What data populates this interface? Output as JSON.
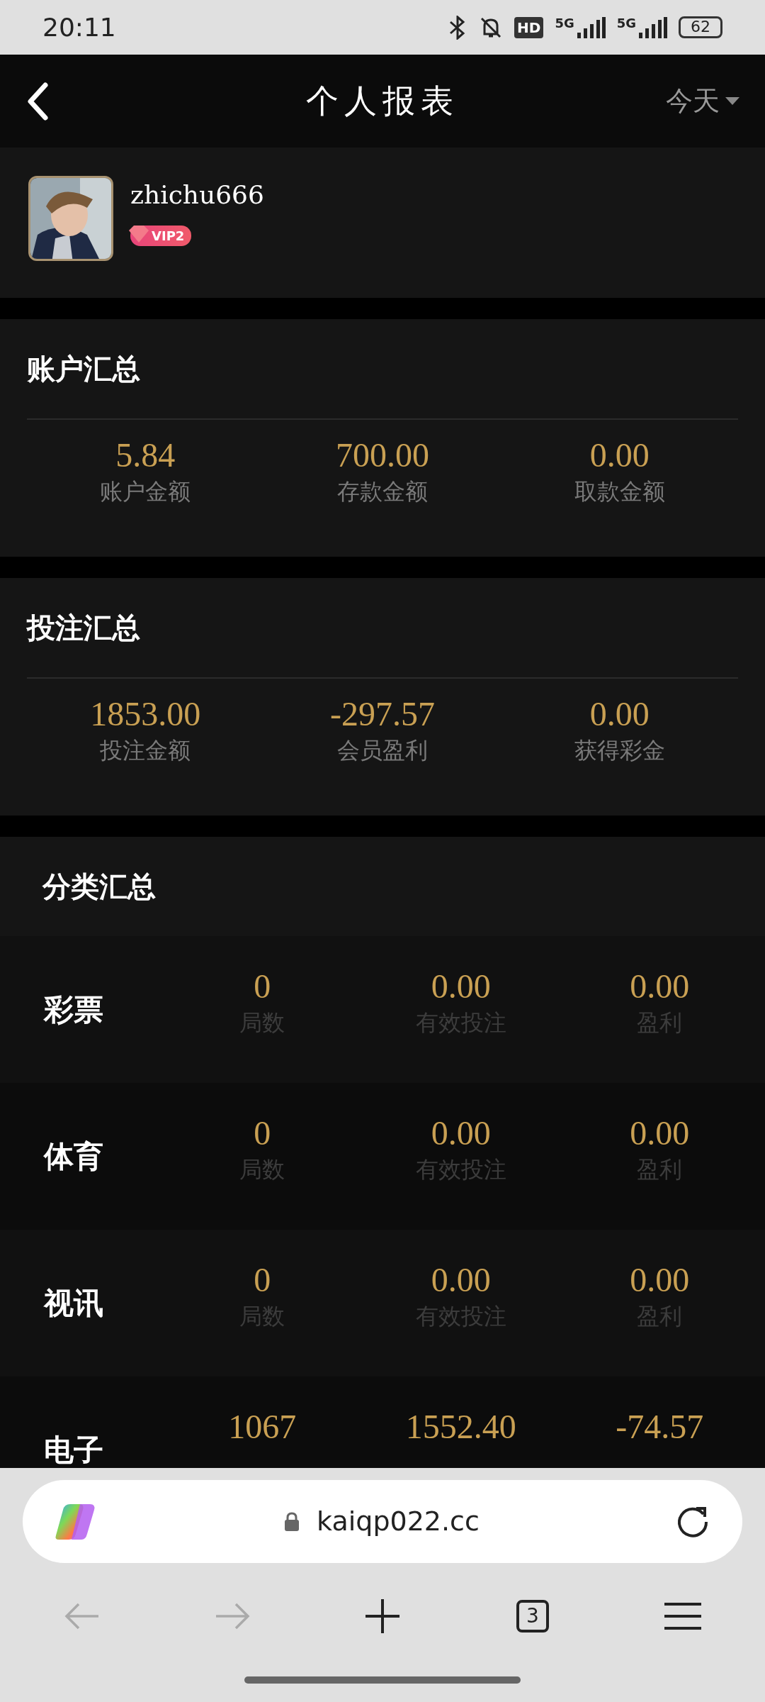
{
  "status_bar": {
    "time": "20:11",
    "network_badges": [
      "HD",
      "5G",
      "5G"
    ],
    "battery": "62"
  },
  "header": {
    "title": "个人报表",
    "period": "今天"
  },
  "profile": {
    "username": "zhichu666",
    "vip": "VIP2"
  },
  "summaries": [
    {
      "title": "账户汇总",
      "stats": [
        {
          "value": "5.84",
          "label": "账户金额"
        },
        {
          "value": "700.00",
          "label": "存款金额"
        },
        {
          "value": "0.00",
          "label": "取款金额"
        }
      ]
    },
    {
      "title": "投注汇总",
      "stats": [
        {
          "value": "1853.00",
          "label": "投注金额"
        },
        {
          "value": "-297.57",
          "label": "会员盈利"
        },
        {
          "value": "0.00",
          "label": "获得彩金"
        }
      ]
    }
  ],
  "categories": {
    "title": "分类汇总",
    "rows": [
      {
        "name": "彩票",
        "stats": [
          {
            "value": "0",
            "label": "局数"
          },
          {
            "value": "0.00",
            "label": "有效投注"
          },
          {
            "value": "0.00",
            "label": "盈利"
          }
        ]
      },
      {
        "name": "体育",
        "stats": [
          {
            "value": "0",
            "label": "局数"
          },
          {
            "value": "0.00",
            "label": "有效投注"
          },
          {
            "value": "0.00",
            "label": "盈利"
          }
        ]
      },
      {
        "name": "视讯",
        "stats": [
          {
            "value": "0",
            "label": "局数"
          },
          {
            "value": "0.00",
            "label": "有效投注"
          },
          {
            "value": "0.00",
            "label": "盈利"
          }
        ]
      },
      {
        "name": "电子",
        "stats": [
          {
            "value": "1067"
          },
          {
            "value": "1552.40"
          },
          {
            "value": "-74.57"
          }
        ]
      }
    ]
  },
  "browser": {
    "url": "kaiqp022.cc",
    "tab_count": "3",
    "nav": [
      {
        "kind": "back",
        "disabled": true
      },
      {
        "kind": "forward",
        "disabled": true
      },
      {
        "kind": "new-tab",
        "disabled": false
      },
      {
        "kind": "tabs",
        "disabled": false
      },
      {
        "kind": "menu",
        "disabled": false
      }
    ]
  }
}
